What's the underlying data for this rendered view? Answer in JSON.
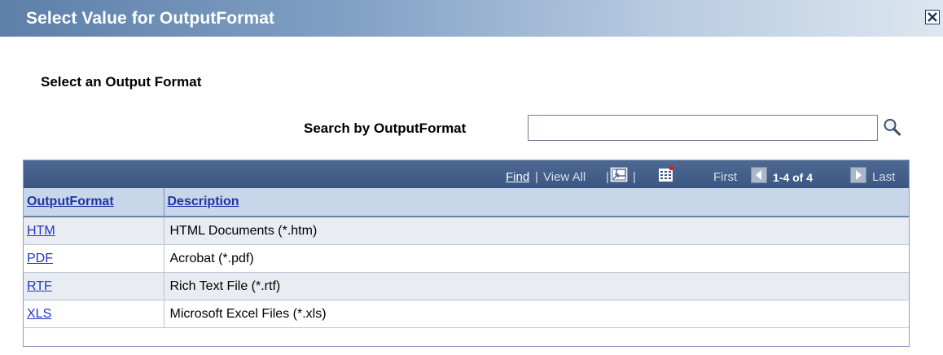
{
  "window": {
    "title": "Select Value for OutputFormat"
  },
  "section": {
    "heading": "Select an Output Format"
  },
  "search": {
    "label": "Search by OutputFormat",
    "value": "",
    "placeholder": ""
  },
  "grid_nav": {
    "find": "Find",
    "separator": "|",
    "view_all": "View All",
    "first": "First",
    "count": "1-4 of 4",
    "last": "Last"
  },
  "table": {
    "columns": [
      "OutputFormat",
      "Description"
    ],
    "rows": [
      {
        "code": "HTM",
        "description": "HTML Documents (*.htm)"
      },
      {
        "code": "PDF",
        "description": "Acrobat (*.pdf)"
      },
      {
        "code": "RTF",
        "description": "Rich Text File (*.rtf)"
      },
      {
        "code": "XLS",
        "description": "Microsoft Excel Files (*.xls)"
      }
    ]
  },
  "icons": {
    "close": "close-icon",
    "search": "magnifier-search-icon",
    "zoom": "grid-zoom-icon",
    "download": "download-to-excel-icon",
    "prev": "previous-arrow-icon",
    "next": "next-arrow-icon"
  },
  "colors": {
    "titlebar_start": "#5d7fa8",
    "grid_header": "#3a5682",
    "column_header": "#c7d6e8",
    "link": "#1f35c9",
    "row_alt": "#e9ecf2"
  }
}
